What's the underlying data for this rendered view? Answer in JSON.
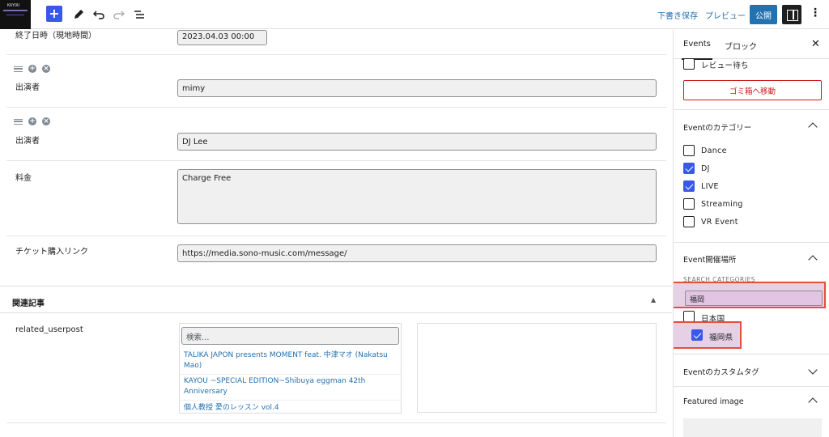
{
  "toolbar": {
    "logo_text": "KAYOU",
    "add_icon": "plus",
    "tool_icons": [
      "pen-icon",
      "undo-icon",
      "redo-icon",
      "list-view-icon"
    ],
    "save_draft_label": "下書き保存",
    "preview_label": "プレビュー",
    "publish_label": "公開"
  },
  "main": {
    "end_datetime": {
      "label": "終了日時（現地時間）",
      "value": "2023.04.03 00:00"
    },
    "performers": [
      {
        "label": "出演者",
        "value": "mimy"
      },
      {
        "label": "出演者",
        "value": "DJ Lee"
      }
    ],
    "fee": {
      "label": "料金",
      "value": "Charge Free"
    },
    "ticket_link": {
      "label": "チケット購入リンク",
      "value": "https://media.sono-music.com/message/"
    },
    "related_section": {
      "title": "関連記事",
      "field_label": "related_userpost",
      "search_placeholder": "検索…",
      "items": [
        "TALIKA JAPON presents MOMENT feat. 中津マオ (Nakatsu Mao)",
        "KAYOU ~SPECIAL EDITION~Shibuya eggman 42th Anniversary",
        "個人教授 愛のレッスン vol.4"
      ]
    }
  },
  "sidebar": {
    "tabs": [
      "Events",
      "ブロック"
    ],
    "pending_review": {
      "label": "レビュー待ち",
      "checked": false
    },
    "trash_label": "ゴミ箱へ移動",
    "categories_panel": {
      "title": "Eventのカテゴリー",
      "items": [
        {
          "label": "Dance",
          "checked": false
        },
        {
          "label": "DJ",
          "checked": true
        },
        {
          "label": "LIVE",
          "checked": true
        },
        {
          "label": "Streaming",
          "checked": false
        },
        {
          "label": "VR Event",
          "checked": false
        }
      ]
    },
    "venue_panel": {
      "title": "Event開催場所",
      "search_label": "SEARCH CATEGORIES",
      "search_value": "福岡",
      "items": [
        {
          "label": "日本国",
          "checked": false
        },
        {
          "label": "福岡県",
          "checked": true
        }
      ]
    },
    "tags_panel": {
      "title": "Eventのカスタムタグ"
    },
    "featured_panel": {
      "title": "Featured image"
    }
  },
  "colors": {
    "accent": "#3858e9",
    "link": "#2271b1",
    "danger": "#cc1818",
    "highlight": "#e74c3c"
  }
}
